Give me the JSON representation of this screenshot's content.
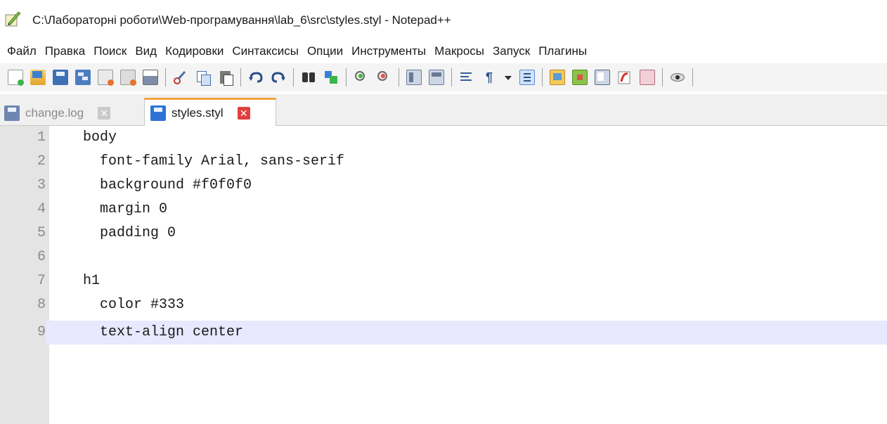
{
  "window": {
    "title": "C:\\Лабораторні роботи\\Web-програмування\\lab_6\\src\\styles.styl - Notepad++",
    "app_icon": "notepad-plus-plus-icon"
  },
  "menu": {
    "items": [
      "Файл",
      "Правка",
      "Поиск",
      "Вид",
      "Кодировки",
      "Синтаксисы",
      "Опции",
      "Инструменты",
      "Макросы",
      "Запуск",
      "Плагины"
    ]
  },
  "toolbar": {
    "icons": [
      "new-file-icon",
      "open-file-icon",
      "save-icon",
      "save-all-icon",
      "close-icon",
      "close-all-icon",
      "print-icon",
      "cut-icon",
      "copy-icon",
      "paste-icon",
      "undo-icon",
      "redo-icon",
      "find-icon",
      "replace-icon",
      "zoom-in-icon",
      "zoom-out-icon",
      "sync-vertical-icon",
      "sync-horizontal-icon",
      "word-wrap-icon",
      "show-all-characters-icon",
      "indent-guide-dropdown-icon",
      "indent-guide-icon",
      "user-defined-language-icon",
      "document-map-icon",
      "function-list-icon",
      "folder-as-workspace-icon",
      "monitoring-icon",
      "macro-record-icon"
    ]
  },
  "tabs": [
    {
      "label": "change.log",
      "active": false
    },
    {
      "label": "styles.styl",
      "active": true
    }
  ],
  "editor": {
    "current_line": 9,
    "lines": [
      {
        "num": "1",
        "text": "body"
      },
      {
        "num": "2",
        "text": "  font-family Arial, sans-serif"
      },
      {
        "num": "3",
        "text": "  background #f0f0f0"
      },
      {
        "num": "4",
        "text": "  margin 0"
      },
      {
        "num": "5",
        "text": "  padding 0"
      },
      {
        "num": "6",
        "text": ""
      },
      {
        "num": "7",
        "text": "h1"
      },
      {
        "num": "8",
        "text": "  color #333"
      },
      {
        "num": "9",
        "text": "  text-align center"
      }
    ]
  },
  "colors": {
    "current_line_highlight": "#e8e8ff",
    "active_tab_accent": "#f3a33a",
    "tab_close_active": "#e0413e"
  }
}
